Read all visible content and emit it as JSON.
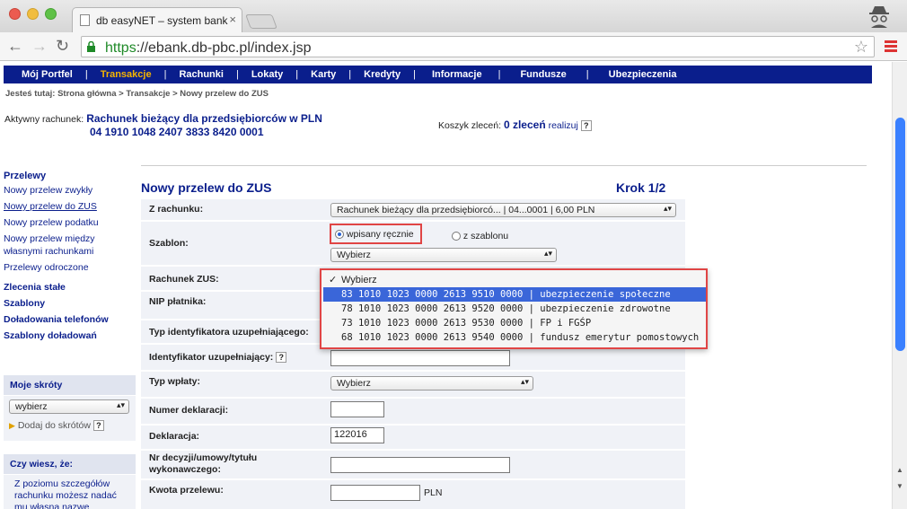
{
  "browser": {
    "tab_title": "db easyNET – system bank",
    "url_scheme": "https",
    "url_rest": "://ebank.db-pbc.pl/index.jsp"
  },
  "nav": {
    "items": [
      "Mój Portfel",
      "Transakcje",
      "Rachunki",
      "Lokaty",
      "Karty",
      "Kredyty",
      "Informacje",
      "Fundusze",
      "Ubezpieczenia"
    ],
    "active": "Transakcje"
  },
  "breadcrumb": "Jesteś tutaj:  Strona główna  >  Transakcje  >  Nowy przelew do ZUS",
  "account": {
    "label": "Aktywny rachunek:",
    "name": "Rachunek bieżący dla przedsiębiorców w PLN",
    "number": "04 1910 1048 2407 3833 8420 0001"
  },
  "cart": {
    "label": "Koszyk zleceń:",
    "count": "0 zleceń",
    "action": "realizuj",
    "help": "?"
  },
  "sidebar": {
    "header": "Przelewy",
    "links": [
      "Nowy przelew zwykły",
      "Nowy przelew do ZUS",
      "Nowy przelew podatku",
      "Nowy przelew między własnymi rachunkami",
      "Przelewy odroczone"
    ],
    "sections": [
      "Zlecenia stałe",
      "Szablony",
      "Doładowania telefonów",
      "Szablony doładowań"
    ],
    "shortcuts_title": "Moje skróty",
    "shortcuts_select": "wybierz",
    "add_shortcut": "Dodaj do skrótów",
    "help": "?",
    "tip_title": "Czy wiesz, że:",
    "tip_text": "Z poziomu szczegółów rachunku możesz nadać mu własną nazwę"
  },
  "form": {
    "title": "Nowy przelew do ZUS",
    "step": "Krok 1/2",
    "from_label": "Z rachunku:",
    "from_value": "Rachunek bieżący dla przedsiębiorcó... | 04...0001 | 6,00 PLN",
    "template_label": "Szablon:",
    "radio_manual": "wpisany ręcznie",
    "radio_template": "z szablonu",
    "template_select": "Wybierz",
    "zus_label": "Rachunek ZUS:",
    "nip_label": "NIP płatnika:",
    "type_label": "Typ identyfikatora uzupełniającego:",
    "id_label": "Identyfikator uzupełniający:",
    "payment_type_label": "Typ wpłaty:",
    "payment_type_value": "Wybierz",
    "decl_no_label": "Numer deklaracji:",
    "decl_label": "Deklaracja:",
    "decl_value": "122016",
    "decision_label": "Nr decyzji/umowy/tytułu wykonawczego:",
    "amount_label": "Kwota przelewu:",
    "currency": "PLN",
    "help": "?"
  },
  "dropdown": {
    "options": [
      "Wybierz",
      "83 1010 1023 0000 2613 9510 0000 | ubezpieczenie społeczne",
      "78 1010 1023 0000 2613 9520 0000 | ubezpieczenie zdrowotne",
      "73 1010 1023 0000 2613 9530 0000 | FP i FGŚP",
      "68 1010 1023 0000 2613 9540 0000 | fundusz emerytur pomostowych"
    ],
    "checked_index": 0,
    "highlight_index": 1
  }
}
